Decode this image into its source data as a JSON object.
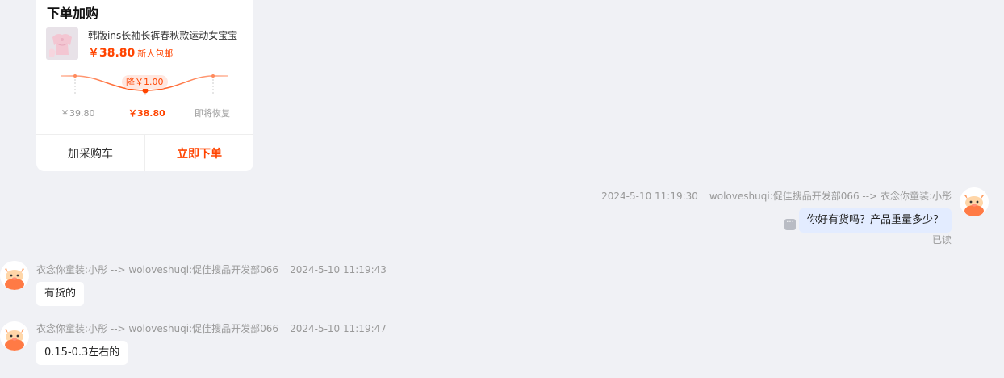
{
  "order_card": {
    "title": "下单加购",
    "product": {
      "name": "韩版ins长袖长裤春秋款运动女宝宝",
      "price": "￥38.80",
      "promo": "新人包邮"
    },
    "price_trend": {
      "drop_label": "降￥1.00",
      "original_price": "￥39.80",
      "current_price": "￥38.80",
      "future_label": "即将恢复"
    },
    "add_to_cart_label": "加采购车",
    "order_now_label": "立即下单"
  },
  "messages": [
    {
      "direction": "out",
      "timestamp": "2024-5-10 11:19:30",
      "route": "woloveshuqi:促佳搜品开发部066 --> 衣念你童装:小彤",
      "text": "你好有货吗？产品重量多少？",
      "status": "已读",
      "icons": [
        "avatar-icon",
        "more-icon"
      ]
    },
    {
      "direction": "in",
      "timestamp": "2024-5-10 11:19:43",
      "route": "衣念你童装:小彤 --> woloveshuqi:促佳搜品开发部066",
      "text": "有货的",
      "icons": [
        "avatar-icon"
      ]
    },
    {
      "direction": "in",
      "timestamp": "2024-5-10 11:19:47",
      "route": "衣念你童装:小彤 --> woloveshuqi:促佳搜品开发部066",
      "text": "0.15-0.3左右的",
      "icons": [
        "avatar-icon"
      ]
    }
  ],
  "colors": {
    "background": "#f0f1f5",
    "accent": "#ff4400",
    "outgoing_bubble": "#e3ecff",
    "incoming_bubble": "#ffffff",
    "avatar_orange": "#ff7a45"
  }
}
